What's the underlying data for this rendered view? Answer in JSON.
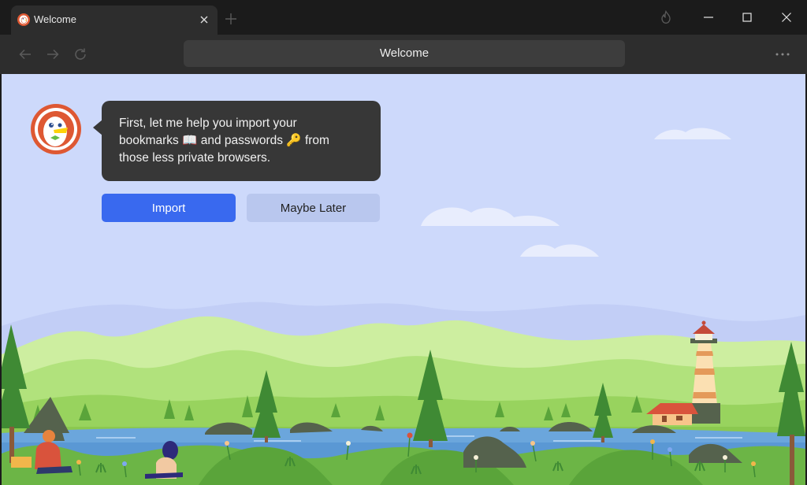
{
  "window": {
    "tab_title": "Welcome",
    "address_text": "Welcome",
    "icons": {
      "favicon": "duckduckgo-logo-icon",
      "close_tab": "close-icon",
      "new_tab": "plus-icon",
      "fire": "fire-icon",
      "minimize": "minimize-icon",
      "maximize": "maximize-icon",
      "close_window": "close-icon",
      "back": "back-arrow-icon",
      "forward": "forward-arrow-icon",
      "reload": "reload-icon",
      "menu": "more-horizontal-icon"
    }
  },
  "onboarding": {
    "message_line1": "First, let me help you import your",
    "message_line2_a": "bookmarks",
    "message_line2_emoji1": "📖",
    "message_line2_b": "and passwords",
    "message_line2_emoji2": "🔑",
    "message_line2_c": "from",
    "message_line3": "those less private browsers.",
    "import_label": "Import",
    "later_label": "Maybe Later"
  },
  "colors": {
    "accent": "#3969ef",
    "sky": "#cdd9fb",
    "bubble": "#373737",
    "secondary_button": "#b9c7ee"
  }
}
